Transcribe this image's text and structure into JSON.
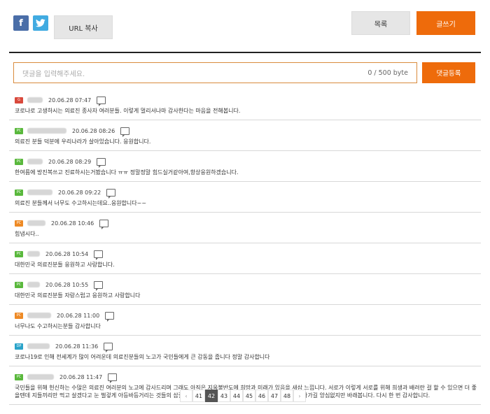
{
  "toolbar": {
    "facebook_icon": "f",
    "twitter_icon": "t",
    "url_copy_label": "URL 복사",
    "list_label": "목록",
    "write_label": "글쓰기"
  },
  "comment_form": {
    "placeholder": "댓글을 입력해주세요.",
    "byte_count": "0 / 500 byte",
    "submit_label": "댓글등록"
  },
  "comments": [
    {
      "badge": "G",
      "badge_color": "#d9493c",
      "date": "20.06.28 07:47",
      "text": "코로나로 고생하시는 의료진 종사자 여러분들. 이렇게 멀리서나마 감사한다는 마음을 전해봅니다."
    },
    {
      "badge": "PC",
      "badge_color": "#59b83c",
      "date": "20.06.28 08:26",
      "text": "의료진 분들 덕분에 우리나라가 살아있습니다. 응원합니다."
    },
    {
      "badge": "PC",
      "badge_color": "#59b83c",
      "date": "20.06.28 08:29",
      "text": "한여름에 방진복쓰고 진료하시는거봤습니다 ㅠㅠ 정말정말 힘드실거같아여,항상응원하겠습니다."
    },
    {
      "badge": "PC",
      "badge_color": "#59b83c",
      "date": "20.06.28 09:22",
      "text": "의료진 분들께서 너무도 수고하시는데요..응원합니다~~"
    },
    {
      "badge": "PC",
      "badge_color": "#ee8a25",
      "date": "20.06.28 10:46",
      "text": "힘냅시다.."
    },
    {
      "badge": "PC",
      "badge_color": "#59b83c",
      "date": "20.06.28 10:54",
      "text": "대한민국 의료진분들 응원하고 사랑합니다."
    },
    {
      "badge": "PC",
      "badge_color": "#59b83c",
      "date": "20.06.28 10:55",
      "text": "대한민국 의료진분들 자랑스럽고 응원하고 사랑합니다"
    },
    {
      "badge": "PC",
      "badge_color": "#ee8a25",
      "date": "20.06.28 11:00",
      "text": "너무나도 수고하시는분들 감사합니다"
    },
    {
      "badge": "DP",
      "badge_color": "#2aa3c9",
      "date": "20.06.28 11:36",
      "text": "코로나19로 인해 전세계가 많이 어려운데 의료진분들의 노고가 국민들에게 큰 감동을 줍니다 정말 감사합니다"
    },
    {
      "badge": "PC",
      "badge_color": "#59b83c",
      "date": "20.06.28 11:47",
      "text": "국민들을 위해 헌신하는 수많은 의료진 여러분의 노고에 감사드리며 그래도 아직은 지옥불반도에 희망과 미래가 있음을 새삼 느낍니다. 서로가 이렇게 서로를 위해 희생과 배려란 걸 할 수 있으면 더 좋을텐데 지들끼리만 먹고 살겠다고 눈 벌겋게 아등바등거리는 것들의 삽질로 고귀하고 숭고한 다짐들이 사그라지지 않고 이어나가길 앙심없지만 바래봅니다. 다시 한 번 감사합니다."
    }
  ],
  "pagination": {
    "prev": "‹",
    "pages": [
      "41",
      "42",
      "43",
      "44",
      "45",
      "46",
      "47",
      "48"
    ],
    "active": "42",
    "next": "›"
  }
}
